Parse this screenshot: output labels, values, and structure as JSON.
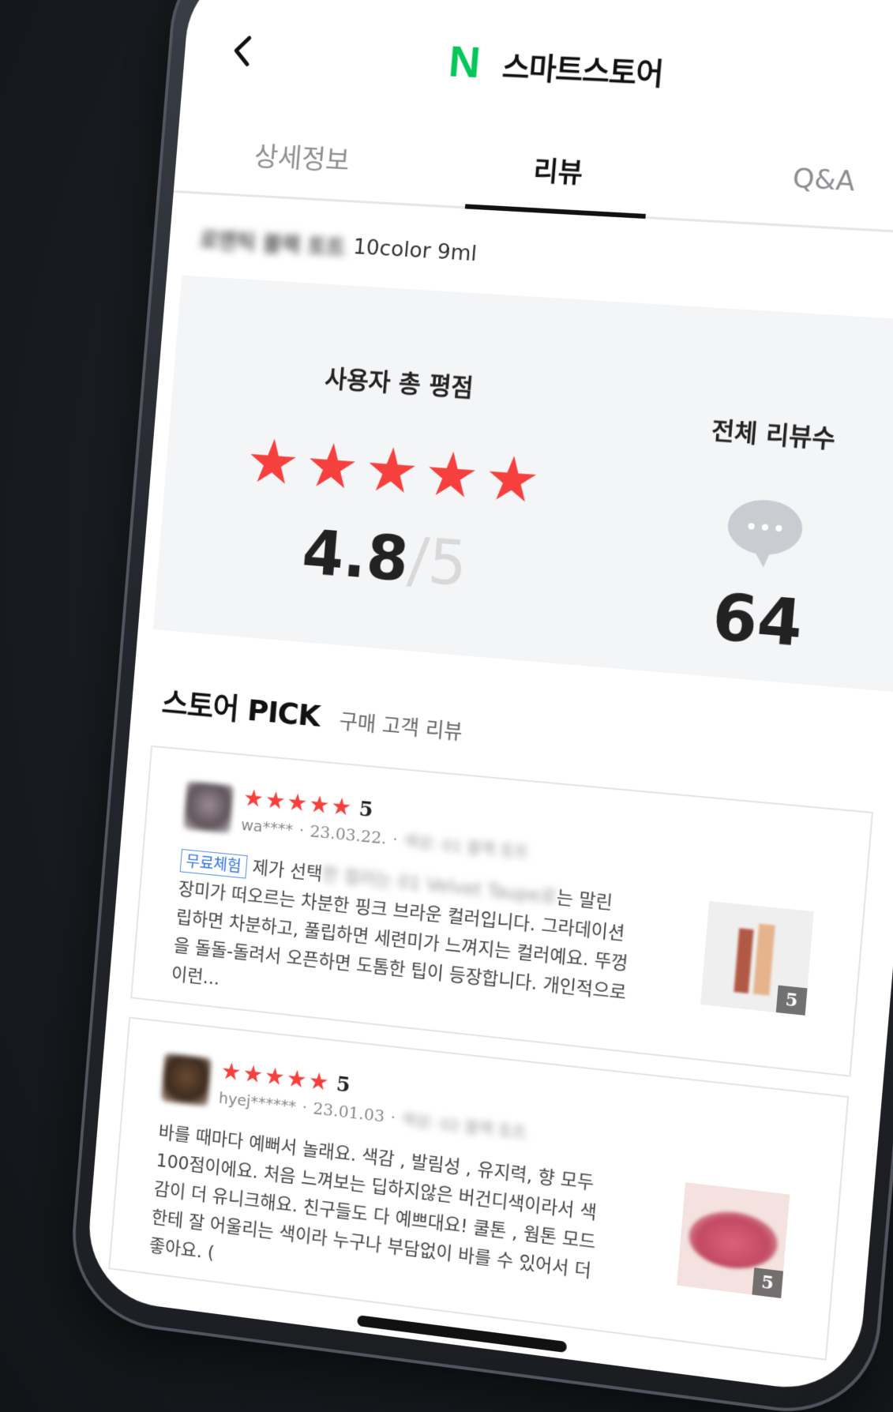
{
  "header": {
    "back_icon": "chevron-left-icon",
    "logo_letter": "N",
    "logo_text": "스마트스토어",
    "search_icon": "search-icon",
    "brand_color": "#03c75a"
  },
  "tabs": [
    {
      "label": "상세정보",
      "active": false
    },
    {
      "label": "리뷰",
      "active": true
    },
    {
      "label": "Q&A",
      "active": false
    }
  ],
  "product": {
    "name_blurred": "로맨틱 블랙 토트",
    "variant": "10color 9ml"
  },
  "rating": {
    "label": "사용자 총 평점",
    "value": "4.8",
    "max": "/5",
    "stars_filled": 4.8,
    "star_color": "#f5403d"
  },
  "total_reviews": {
    "label": "전체 리뷰수",
    "count": "64",
    "icon": "chat-bubble-icon"
  },
  "store_pick": {
    "title": "스토어 PICK",
    "subtitle": "구매 고객 리뷰"
  },
  "reviews": [
    {
      "score": "5",
      "user": "wa****",
      "date": "23.03.22.",
      "option_blurred": "색상: 01 블랙 토트",
      "badge": "무료체험",
      "body_start": "제가 선택",
      "body_blurred": "한 컬러는 01 Velvet Taupe로",
      "body_rest": "는 말린 장미가 떠오르는 차분한 핑크 브라운 컬러입니다. 그라데이션립하면 차분하고, 풀립하면 세련미가 느껴지는 컬러예요. 뚜껑을 돌돌-돌려서 오픈하면 도톰한 팁이 등장합니다. 개인적으로 이런...",
      "thumb_count": "5"
    },
    {
      "score": "5",
      "user": "hyej******",
      "date": "23.01.03",
      "option_blurred": "색상: 02 블랙 토트",
      "body": "바를 때마다 예뻐서 놀래요. 색감 , 발림성 , 유지력, 향 모두 100점이에요. 처음 느껴보는 딥하지않은 버건디색이라서 색감이 더 유니크해요. 친구들도 다 예쁘대요! 쿨톤 , 웜톤 모드한테 잘 어울리는 색이라 누구나 부담없이 바를 수 있어서 더 좋아요. (",
      "thumb_count": "5"
    }
  ]
}
